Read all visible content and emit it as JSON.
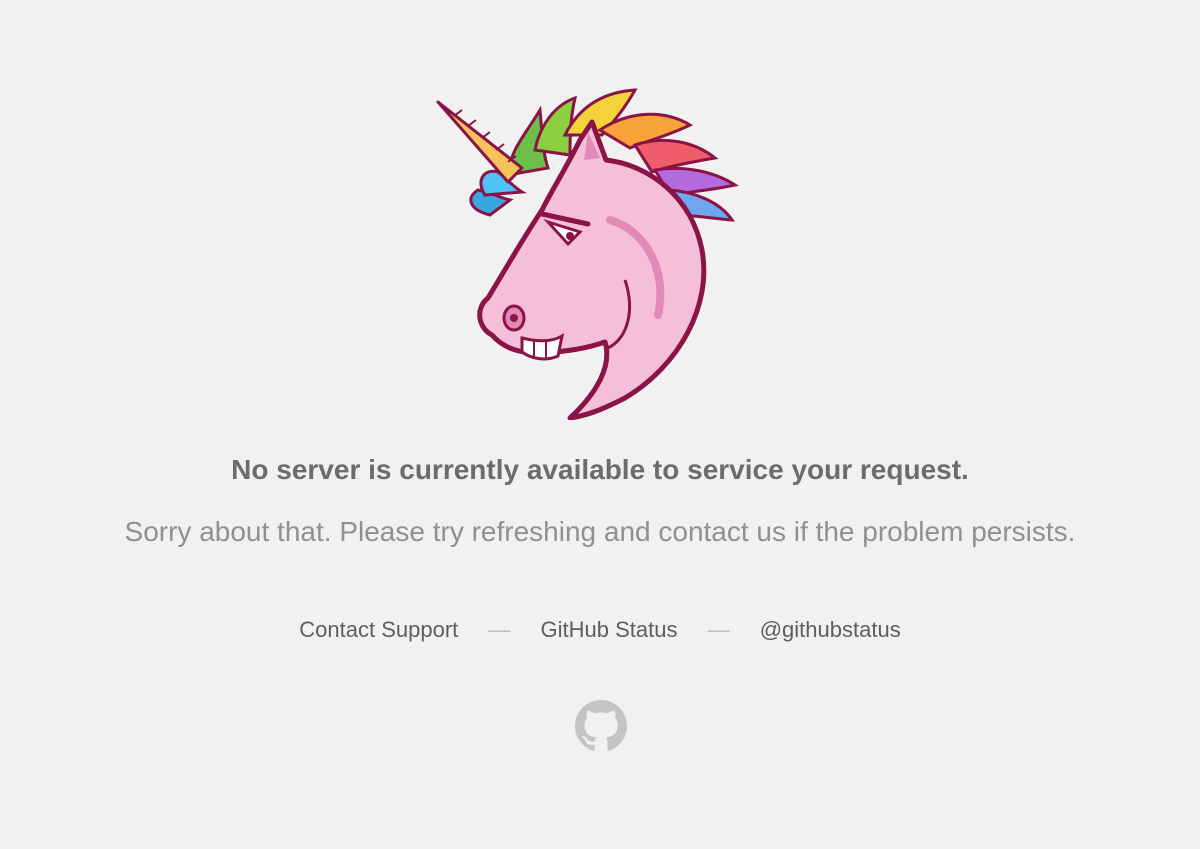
{
  "error": {
    "headline": "No server is currently available to service your request.",
    "message": "Sorry about that. Please try refreshing and contact us if the problem persists."
  },
  "links": [
    {
      "label": "Contact Support"
    },
    {
      "label": "GitHub Status"
    },
    {
      "label": "@githubstatus"
    }
  ],
  "separator": "—",
  "icons": {
    "illustration": "angry-unicorn-illustration",
    "footer": "github-octocat-icon"
  },
  "colors": {
    "background": "#f1f1f1",
    "headline": "#6c6c6c",
    "message": "#909090",
    "links": "#5e5e5e",
    "separator": "#bdbdbd",
    "icon": "#c4c4c4",
    "unicorn_body": "#f6bfd8",
    "unicorn_outline": "#8a1347"
  }
}
